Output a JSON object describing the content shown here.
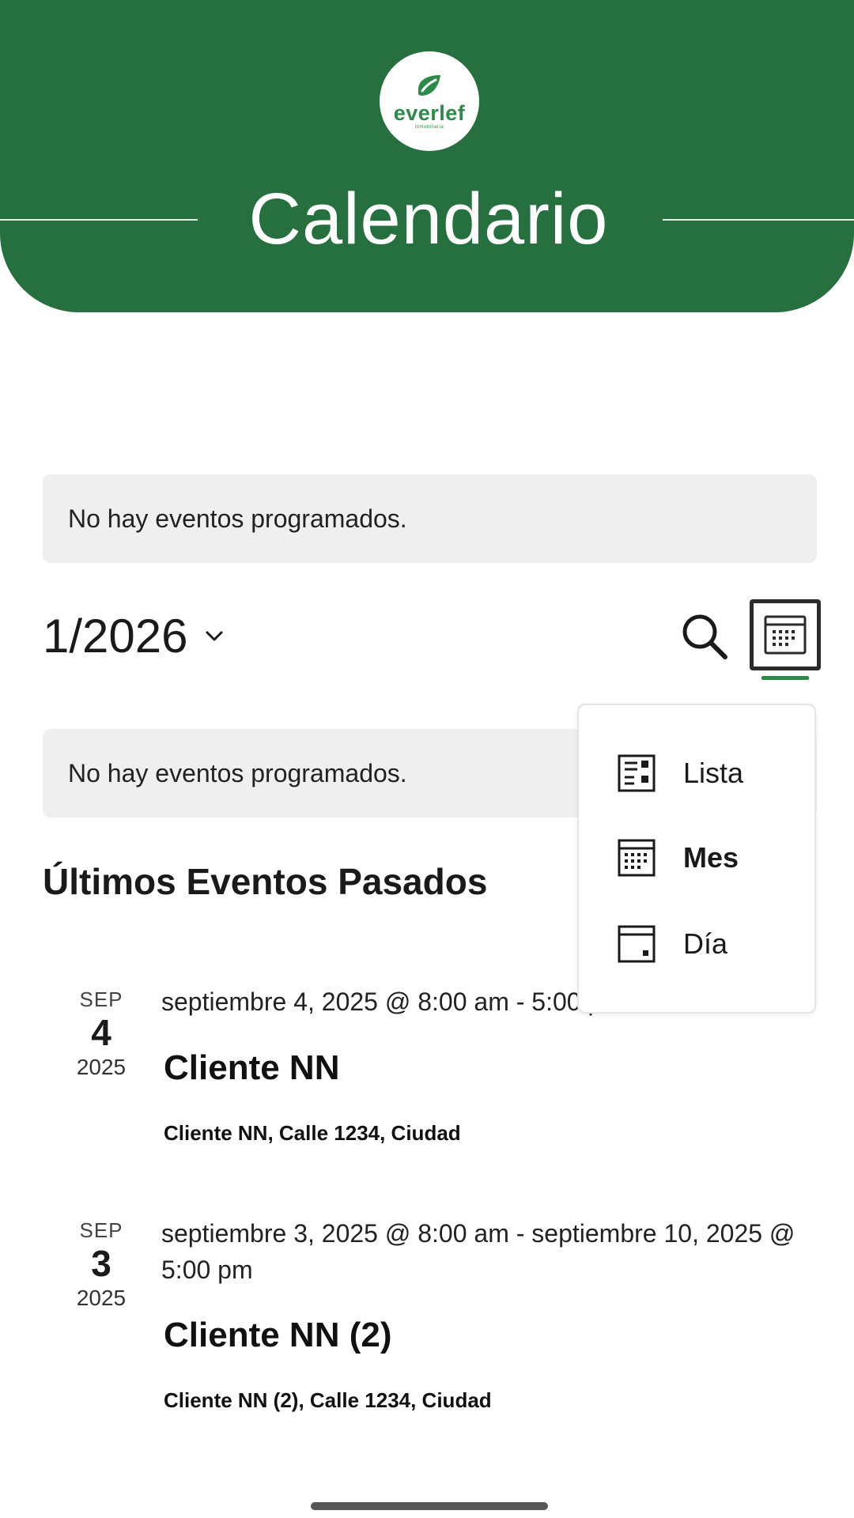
{
  "header": {
    "logo_text": "everlef",
    "logo_subtitle": "inmobiliaria",
    "title": "Calendario",
    "color": "#26703f"
  },
  "notices": {
    "top": "No hay eventos programados.",
    "middle": "No hay eventos programados."
  },
  "nav": {
    "date_label": "1/2026",
    "search_icon": "search-icon",
    "view_icon": "calendar-month-icon"
  },
  "view_menu": {
    "items": [
      {
        "label": "Lista",
        "icon": "list-view-icon",
        "active": false
      },
      {
        "label": "Mes",
        "icon": "month-view-icon",
        "active": true
      },
      {
        "label": "Día",
        "icon": "day-view-icon",
        "active": false
      }
    ]
  },
  "past_events": {
    "title": "Últimos Eventos Pasados",
    "items": [
      {
        "month": "SEP",
        "day": "4",
        "year": "2025",
        "when": "septiembre 4, 2025 @ 8:00 am - 5:00 pm",
        "title": "Cliente NN",
        "venue": "Cliente NN, Calle 1234, Ciudad"
      },
      {
        "month": "SEP",
        "day": "3",
        "year": "2025",
        "when": "septiembre 3, 2025 @ 8:00 am - septiembre 10, 2025 @ 5:00 pm",
        "title": "Cliente NN (2)",
        "venue": "Cliente NN (2), Calle 1234, Ciudad"
      }
    ]
  },
  "accent_color": "#2b8a47"
}
